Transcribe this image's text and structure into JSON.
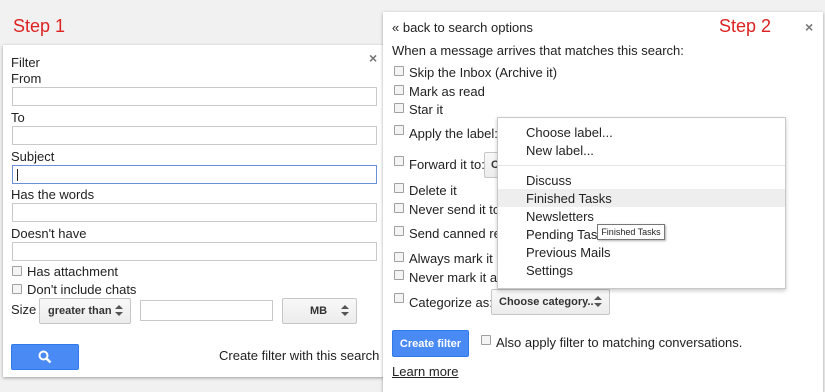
{
  "step1": {
    "label": "Step 1",
    "filter_title": "Filter",
    "close_glyph": "×",
    "fields": {
      "from": "From",
      "to": "To",
      "subject": "Subject",
      "has_words": "Has the words",
      "doesnt_have": "Doesn't have"
    },
    "has_attachment": "Has attachment",
    "dont_include_chats": "Don't include chats",
    "size_label": "Size",
    "size_operator": "greater than",
    "size_unit": "MB",
    "create_link": "Create filter with this search »"
  },
  "step2": {
    "label": "Step 2",
    "close_glyph": "×",
    "back_link": "« back to search options",
    "intro": "When a message arrives that matches this search:",
    "actions": {
      "skip_inbox": "Skip the Inbox (Archive it)",
      "mark_read": "Mark as read",
      "star": "Star it",
      "apply_label": "Apply the label:",
      "forward": "Forward it to:",
      "delete": "Delete it",
      "never_spam": "Never send it to",
      "canned": "Send canned res",
      "always_important": "Always mark it a",
      "never_important": "Never mark it as",
      "categorize": "Categorize as:"
    },
    "forward_select_partial": "C",
    "category_select": "Choose category...",
    "create_button": "Create filter",
    "also_apply": "Also apply filter to matching conversations.",
    "learn_more": "Learn more"
  },
  "label_menu": {
    "items_top": [
      "Choose label...",
      "New label..."
    ],
    "items": [
      "Discuss",
      "Finished Tasks",
      "Newsletters",
      "Pending Tas",
      "Previous Mails",
      "Settings"
    ],
    "highlighted": "Finished Tasks",
    "tooltip": "Finished Tasks"
  },
  "colors": {
    "step_label": "#dd2222",
    "primary_button": "#4a8af4",
    "link": "#1155cc"
  }
}
